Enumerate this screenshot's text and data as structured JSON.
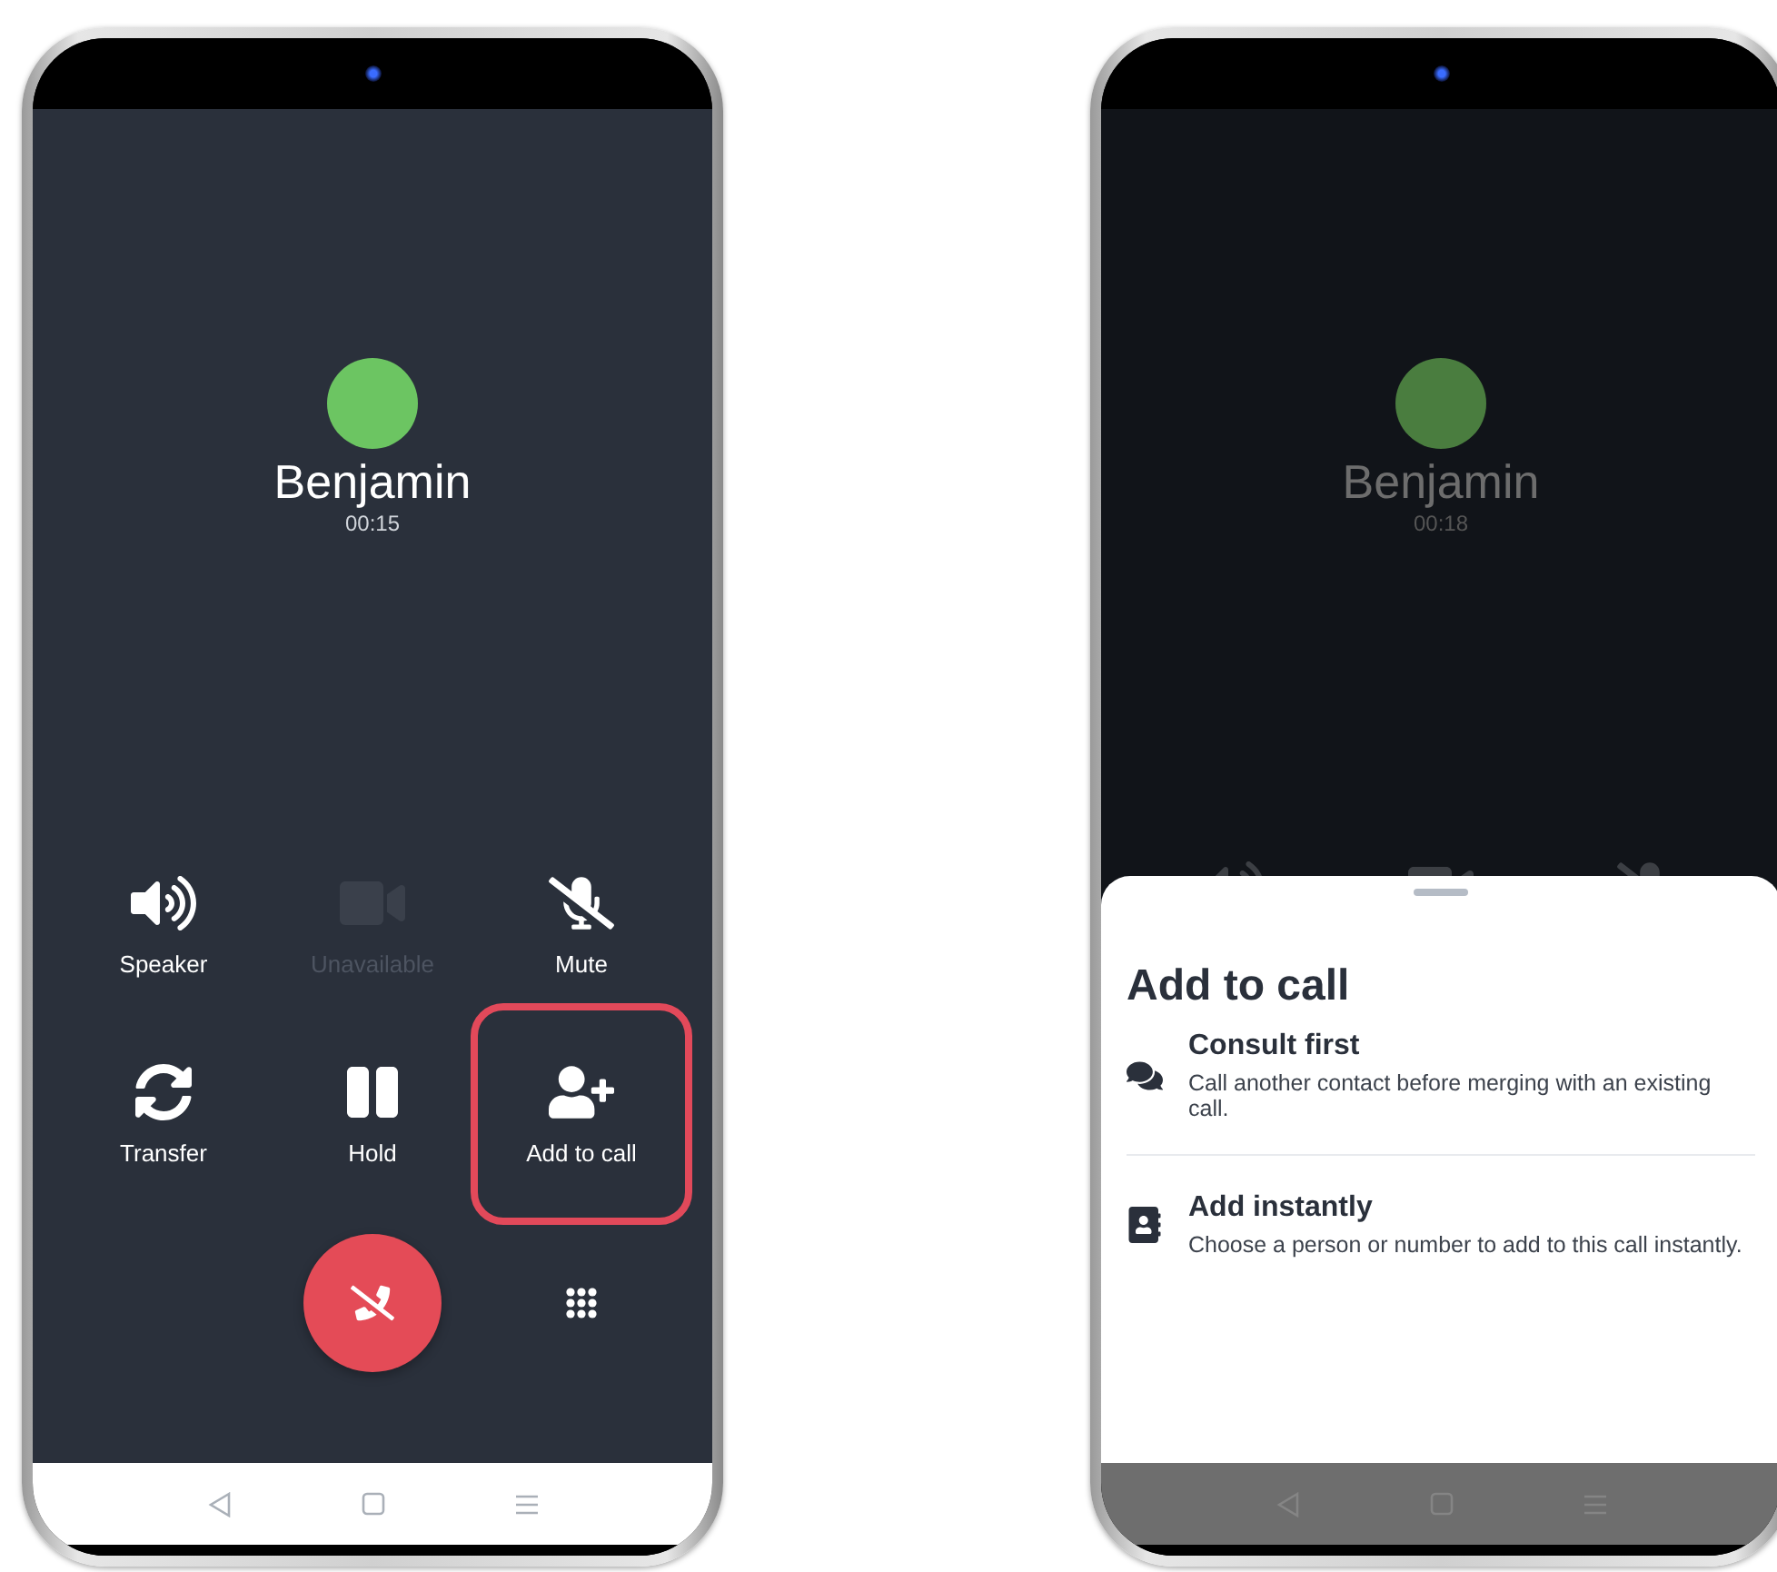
{
  "call_screen": {
    "contact": {
      "name": "Benjamin",
      "duration": "00:15"
    },
    "controls": [
      {
        "label": "Speaker",
        "disabled": false,
        "highlighted": false
      },
      {
        "label": "Unavailable",
        "disabled": true,
        "highlighted": false
      },
      {
        "label": "Mute",
        "disabled": false,
        "highlighted": false
      },
      {
        "label": "Transfer",
        "disabled": false,
        "highlighted": false
      },
      {
        "label": "Hold",
        "disabled": false,
        "highlighted": false
      },
      {
        "label": "Add to call",
        "disabled": false,
        "highlighted": true
      }
    ]
  },
  "sheet_screen": {
    "contact": {
      "name": "Benjamin",
      "duration": "00:18"
    },
    "sheet": {
      "title": "Add to call",
      "options": [
        {
          "title": "Consult first",
          "description": "Call another contact before merging with an existing call."
        },
        {
          "title": "Add instantly",
          "description": "Choose a person or number to add to this call instantly."
        }
      ]
    }
  }
}
